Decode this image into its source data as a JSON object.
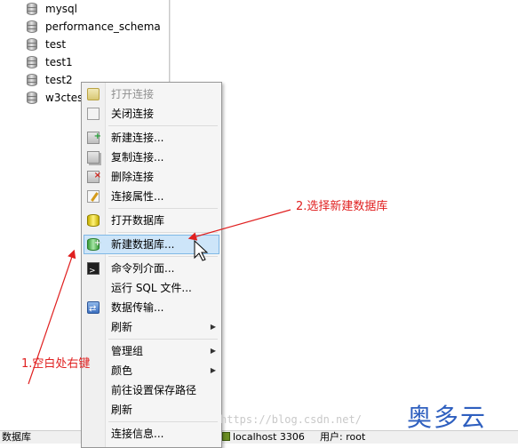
{
  "tree": {
    "items": [
      {
        "label": "mysql",
        "icon": "database-icon"
      },
      {
        "label": "performance_schema",
        "icon": "database-icon"
      },
      {
        "label": "test",
        "icon": "database-icon"
      },
      {
        "label": "test1",
        "icon": "database-icon"
      },
      {
        "label": "test2",
        "icon": "database-icon"
      },
      {
        "label": "w3ctes",
        "icon": "database-icon"
      }
    ]
  },
  "context_menu": {
    "items": [
      {
        "label": "打开连接",
        "icon": "open-connection-icon",
        "disabled": true
      },
      {
        "label": "关闭连接",
        "icon": "close-connection-icon"
      },
      {
        "separator": true
      },
      {
        "label": "新建连接...",
        "icon": "new-connection-icon"
      },
      {
        "label": "复制连接...",
        "icon": "copy-connection-icon"
      },
      {
        "label": "删除连接",
        "icon": "delete-connection-icon"
      },
      {
        "label": "连接属性...",
        "icon": "connection-properties-icon"
      },
      {
        "separator": true
      },
      {
        "label": "打开数据库",
        "icon": "open-database-icon"
      },
      {
        "separator": true
      },
      {
        "label": "新建数据库...",
        "icon": "new-database-icon",
        "highlighted": true
      },
      {
        "separator": true
      },
      {
        "label": "命令列介面...",
        "icon": "console-icon"
      },
      {
        "label": "运行 SQL 文件...",
        "icon": "none"
      },
      {
        "label": "数据传输...",
        "icon": "data-transfer-icon"
      },
      {
        "label": "刷新",
        "icon": "none",
        "submenu": true
      },
      {
        "separator": true
      },
      {
        "label": "管理组",
        "icon": "none",
        "submenu": true
      },
      {
        "label": "颜色",
        "icon": "none",
        "submenu": true
      },
      {
        "label": "前往设置保存路径",
        "icon": "none"
      },
      {
        "label": "刷新",
        "icon": "none"
      },
      {
        "separator": true
      },
      {
        "label": "连接信息...",
        "icon": "none"
      }
    ]
  },
  "status_bar": {
    "left_label": "数据库",
    "connection": "localhost 3306",
    "user": "用户: root"
  },
  "annotations": {
    "step1": "1.空白处右键",
    "step2": "2.选择新建数据库",
    "color": "#e02020"
  },
  "watermark": "https://blog.csdn.net/",
  "brand": "奥多云",
  "colors": {
    "highlight": "#cde5f9",
    "brand": "#2e5fbf"
  }
}
